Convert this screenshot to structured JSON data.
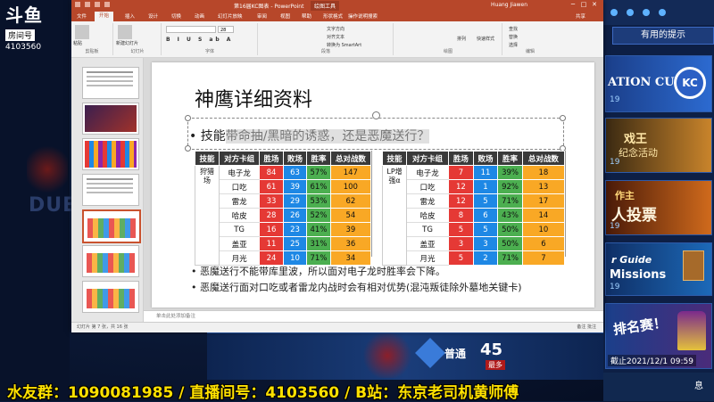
{
  "overlay": {
    "brand": "斗鱼",
    "room_label": "房间号",
    "room_id": "4103560",
    "bg_text": "DUEL",
    "subtitle": "水友群：1090081985 / 直播间号：4103560 / B站：东京老司机黄师傅"
  },
  "game_panel": {
    "header": "有用的提示",
    "banner1_text": "ATION CUP",
    "banner1_logo": "KC",
    "banner1_num": "19",
    "banner2_title": "戏王",
    "banner2_sub": "纪念活动",
    "banner2_num": "19",
    "banner3_title": "作主",
    "banner3_text": "人投票",
    "banner3_num": "19",
    "banner4_t1": "r Guide",
    "banner4_t2": "Missions",
    "banner4_num": "19",
    "banner5_title": "排名赛！",
    "banner5_deadline": "截止2021/12/1 09:59",
    "bottom_label": "息",
    "item_label": "普通",
    "item_count": "45",
    "item_badge": "最多"
  },
  "ppt": {
    "window_title": "第16届KC图表 - PowerPoint",
    "tools_label": "绘图工具",
    "user": "Huang Jiawen",
    "tabs": [
      "文件",
      "开始",
      "插入",
      "设计",
      "切换",
      "动画",
      "幻灯片放映",
      "审阅",
      "视图",
      "帮助",
      "形状格式"
    ],
    "active_tab": "开始",
    "search_placeholder": "操作说明搜索",
    "share": "共享",
    "ribbon": {
      "clipboard": "剪贴板",
      "paste": "粘贴",
      "slides": "幻灯片",
      "new_slide": "新建幻灯片",
      "font": "字体",
      "font_size": "28",
      "paragraph": "段落",
      "text_direction": "文字方向",
      "align_text": "对齐文本",
      "smartart": "转换为 SmartArt",
      "drawing": "绘图",
      "arrange": "排列",
      "quick_styles": "快速样式",
      "editing": "编辑",
      "find": "查找",
      "replace": "替换",
      "select": "选择"
    },
    "notes_placeholder": "单击此处添加备注",
    "status_left": "幻灯片 第 7 张，共 16 张",
    "status_right": "备注  批注"
  },
  "slide": {
    "title": "神鹰详细资料",
    "bullet1_prefix": "• 技能",
    "bullet1_highlight": "带命抽/黑暗的诱惑，还是恶魔送行？",
    "table_left": {
      "headers": [
        "技能",
        "对方卡组",
        "胜场",
        "败场",
        "胜率",
        "总对战数"
      ],
      "group": "狩猎场",
      "rows": [
        [
          "电子龙",
          "84",
          "63",
          "57%",
          "147"
        ],
        [
          "口吃",
          "61",
          "39",
          "61%",
          "100"
        ],
        [
          "雷龙",
          "33",
          "29",
          "53%",
          "62"
        ],
        [
          "哈皮",
          "28",
          "26",
          "52%",
          "54"
        ],
        [
          "TG",
          "16",
          "23",
          "41%",
          "39"
        ],
        [
          "盖亚",
          "11",
          "25",
          "31%",
          "36"
        ],
        [
          "月光",
          "24",
          "10",
          "71%",
          "34"
        ]
      ]
    },
    "table_right": {
      "headers": [
        "技能",
        "对方卡组",
        "胜场",
        "败场",
        "胜率",
        "总对战数"
      ],
      "group": "LP增强α",
      "rows": [
        [
          "电子龙",
          "7",
          "11",
          "39%",
          "18"
        ],
        [
          "口吃",
          "12",
          "1",
          "92%",
          "13"
        ],
        [
          "雷龙",
          "12",
          "5",
          "71%",
          "17"
        ],
        [
          "哈皮",
          "8",
          "6",
          "43%",
          "14"
        ],
        [
          "TG",
          "5",
          "5",
          "50%",
          "10"
        ],
        [
          "盖亚",
          "3",
          "3",
          "50%",
          "6"
        ],
        [
          "月光",
          "5",
          "2",
          "71%",
          "7"
        ]
      ]
    },
    "bullet2": "• 恶魔送行不能带库里波，所以面对电子龙时胜率会下降。",
    "bullet3": "• 恶魔送行面对口吃或者雷龙内战时会有相对优势(混沌叛徒除外墓地关键卡)"
  }
}
